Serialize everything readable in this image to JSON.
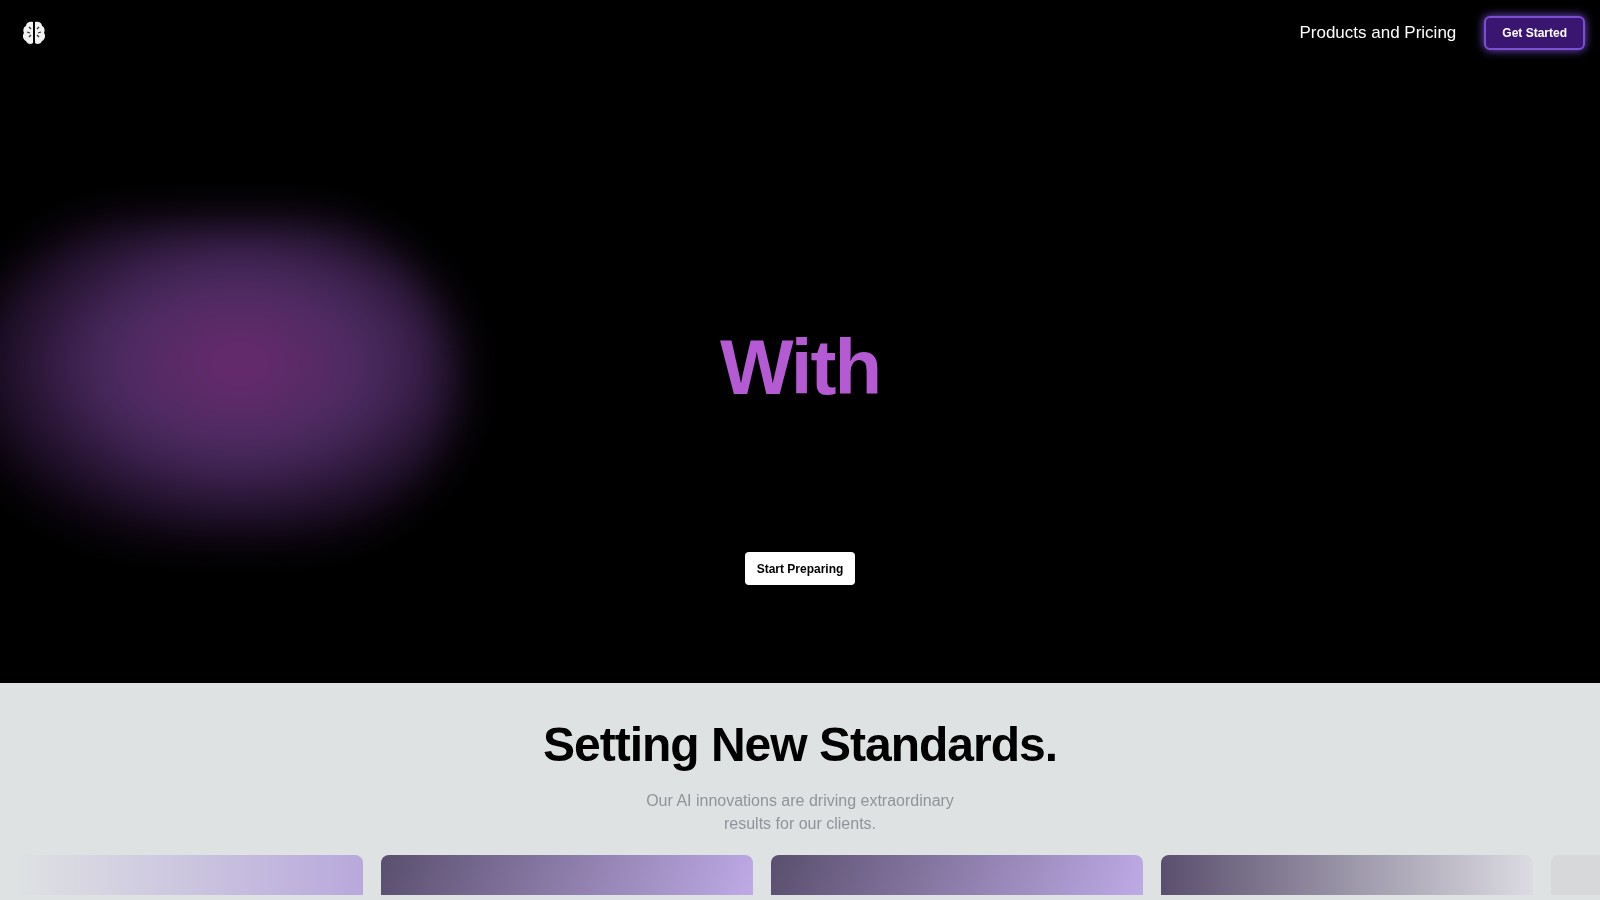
{
  "nav": {
    "links": [
      "Products and Pricing"
    ],
    "cta": "Get Started"
  },
  "hero": {
    "headline": "With",
    "button": "Start Preparing"
  },
  "standards": {
    "title": "Setting New Standards.",
    "subtitle_lines": [
      "Our AI innovations are driving extraordinary",
      "results for our clients."
    ]
  }
}
